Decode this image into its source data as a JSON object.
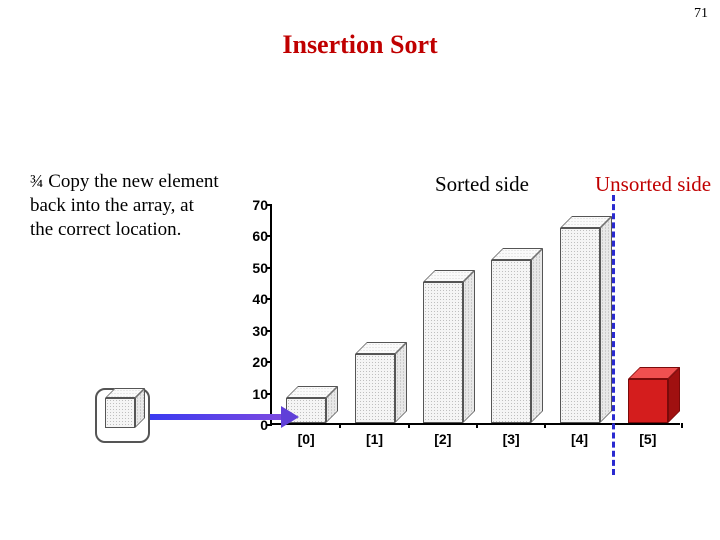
{
  "page_number": "71",
  "title": "Insertion Sort",
  "bullet_icon": "¾",
  "bullet_text": "Copy the new element back into the array, at the correct location.",
  "sorted_label": "Sorted side",
  "unsorted_label": "Unsorted side",
  "chart_data": {
    "type": "bar",
    "categories": [
      "[0]",
      "[1]",
      "[2]",
      "[3]",
      "[4]",
      "[5]"
    ],
    "values": [
      8,
      22,
      45,
      52,
      62,
      14
    ],
    "highlight_index": 5,
    "partition_after_index": 4,
    "ylim": [
      0,
      70
    ],
    "yticks": [
      0,
      10,
      20,
      30,
      40,
      50,
      60,
      70
    ],
    "xlabel": "",
    "ylabel": "",
    "title": ""
  },
  "floating_element_value": 8
}
